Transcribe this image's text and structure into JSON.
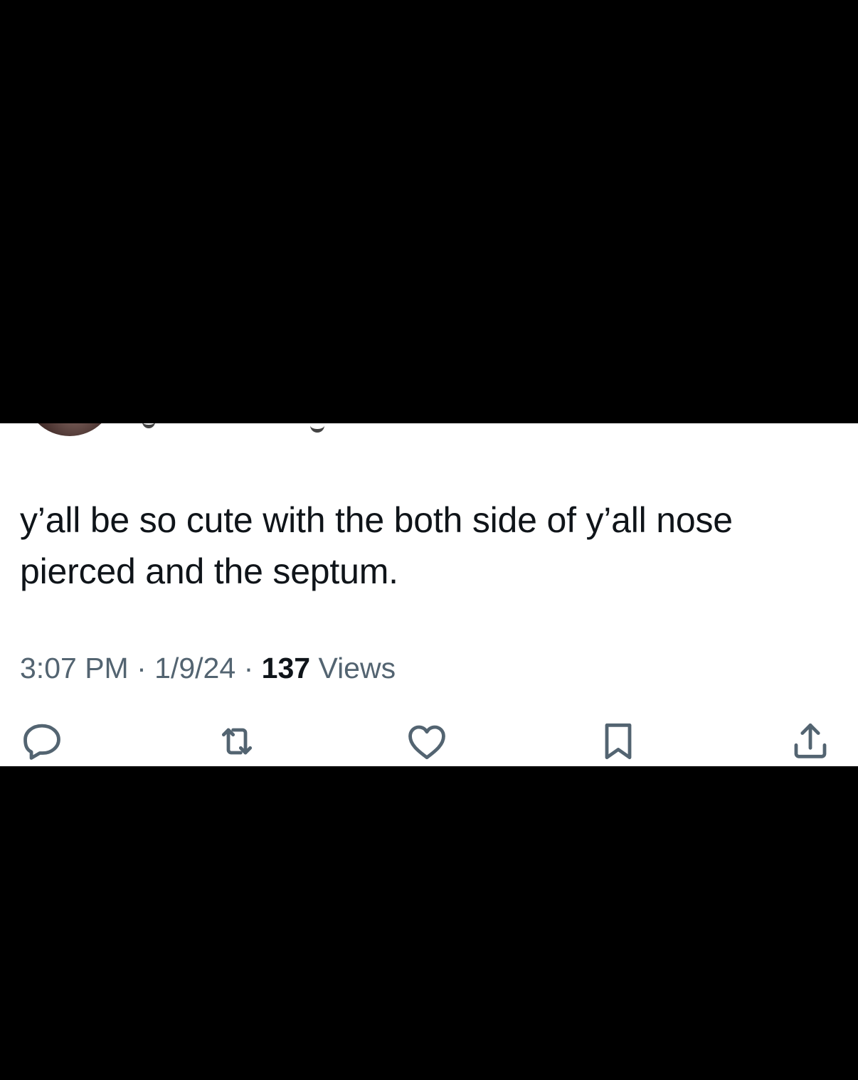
{
  "tweet": {
    "text": "y’all be so cute with the both side of y’all nose pierced and the septum.",
    "time": "3:07 PM",
    "separator": "·",
    "date": "1/9/24",
    "views_count": "137",
    "views_label": "Views"
  },
  "actions": {
    "reply_icon": "reply-icon",
    "retweet_icon": "retweet-icon",
    "like_icon": "heart-icon",
    "bookmark_icon": "bookmark-icon",
    "share_icon": "share-icon"
  },
  "colors": {
    "background": "#000000",
    "card": "#ffffff",
    "text": "#0f1419",
    "secondary": "#536471"
  }
}
